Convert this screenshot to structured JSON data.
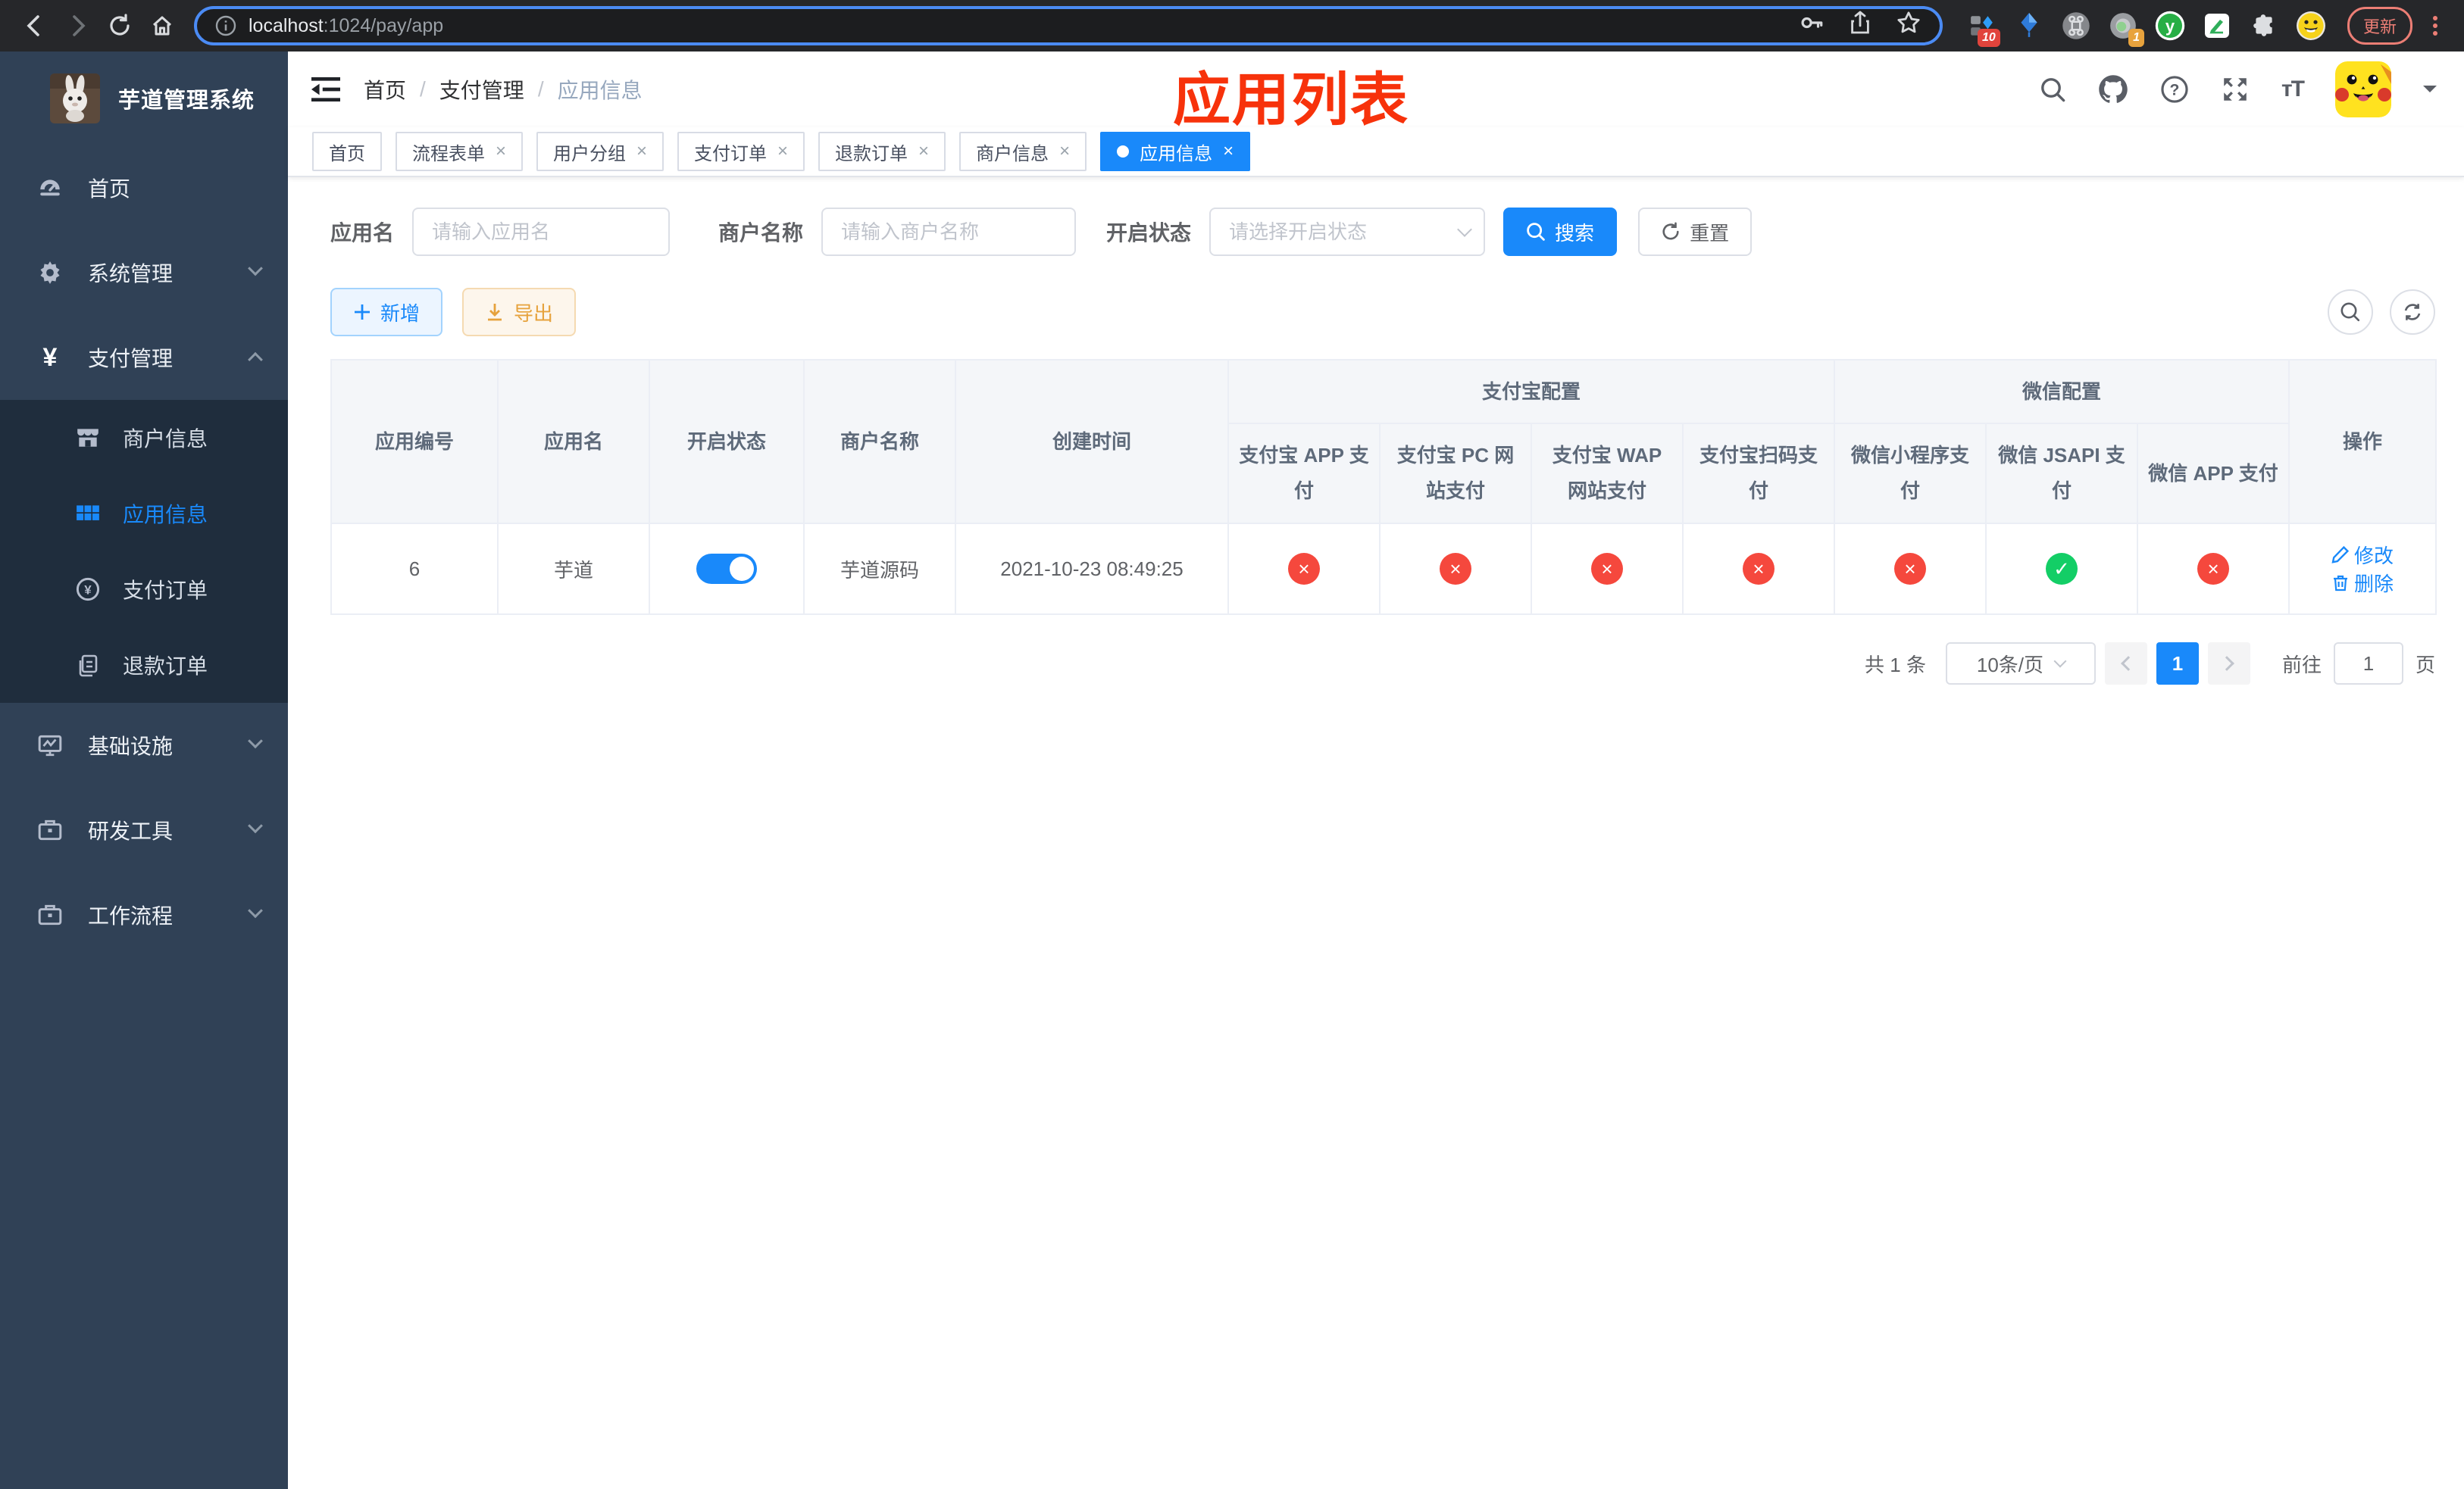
{
  "browser": {
    "url": {
      "host": "localhost",
      "path": ":1024/pay/app"
    },
    "update_label": "更新",
    "ext_badge_10": "10",
    "ext_badge_1": "1"
  },
  "sidebar": {
    "title": "芋道管理系统",
    "items": [
      {
        "label": "首页"
      },
      {
        "label": "系统管理"
      },
      {
        "label": "支付管理"
      },
      {
        "label": "商户信息"
      },
      {
        "label": "应用信息"
      },
      {
        "label": "支付订单"
      },
      {
        "label": "退款订单"
      },
      {
        "label": "基础设施"
      },
      {
        "label": "研发工具"
      },
      {
        "label": "工作流程"
      }
    ]
  },
  "header": {
    "breadcrumb": {
      "home": "首页",
      "section": "支付管理",
      "current": "应用信息",
      "sep": "/"
    },
    "overlay_title": "应用列表",
    "font_icon": "тT"
  },
  "tabs": [
    {
      "label": "首页"
    },
    {
      "label": "流程表单"
    },
    {
      "label": "用户分组"
    },
    {
      "label": "支付订单"
    },
    {
      "label": "退款订单"
    },
    {
      "label": "商户信息"
    },
    {
      "label": "应用信息"
    }
  ],
  "ui": {
    "close": "×"
  },
  "filters": {
    "name_label": "应用名",
    "name_placeholder": "请输入应用名",
    "merchant_label": "商户名称",
    "merchant_placeholder": "请输入商户名称",
    "status_label": "开启状态",
    "status_placeholder": "请选择开启状态",
    "search": "搜索",
    "reset": "重置"
  },
  "toolbar": {
    "add": "新增",
    "export": "导出"
  },
  "table": {
    "columns": [
      "应用编号",
      "应用名",
      "开启状态",
      "商户名称",
      "创建时间"
    ],
    "groups": [
      "支付宝配置",
      "微信配置"
    ],
    "pay_columns": [
      "支付宝 APP 支付",
      "支付宝 PC 网站支付",
      "支付宝 WAP 网站支付",
      "支付宝扫码支付",
      "微信小程序支付",
      "微信 JSAPI 支付",
      "微信 APP 支付"
    ],
    "ops": "操作",
    "rows": [
      {
        "id": "6",
        "name": "芋道",
        "enabled": true,
        "merchant": "芋道源码",
        "created": "2021-10-23 08:49:25",
        "statuses": [
          {
            "enabled": false,
            "glyph": "×"
          },
          {
            "enabled": false,
            "glyph": "×"
          },
          {
            "enabled": false,
            "glyph": "×"
          },
          {
            "enabled": false,
            "glyph": "×"
          },
          {
            "enabled": false,
            "glyph": "×"
          },
          {
            "enabled": true,
            "glyph": "✓"
          },
          {
            "enabled": false,
            "glyph": "×"
          }
        ],
        "actions": {
          "edit": "修改",
          "delete": "删除"
        }
      }
    ]
  },
  "pagination": {
    "total": "共 1 条",
    "size": "10条/页",
    "page": "1",
    "goto_label": "前往",
    "goto_value": "1",
    "unit": "页"
  },
  "colors": {
    "accent": "#1989fa",
    "sidebar_bg": "#304156",
    "submenu_bg": "#1f2d3d",
    "status_off": "#f5483d",
    "status_on": "#13ce66",
    "warning": "#e6a23c",
    "overlay_red": "#f7320b"
  }
}
